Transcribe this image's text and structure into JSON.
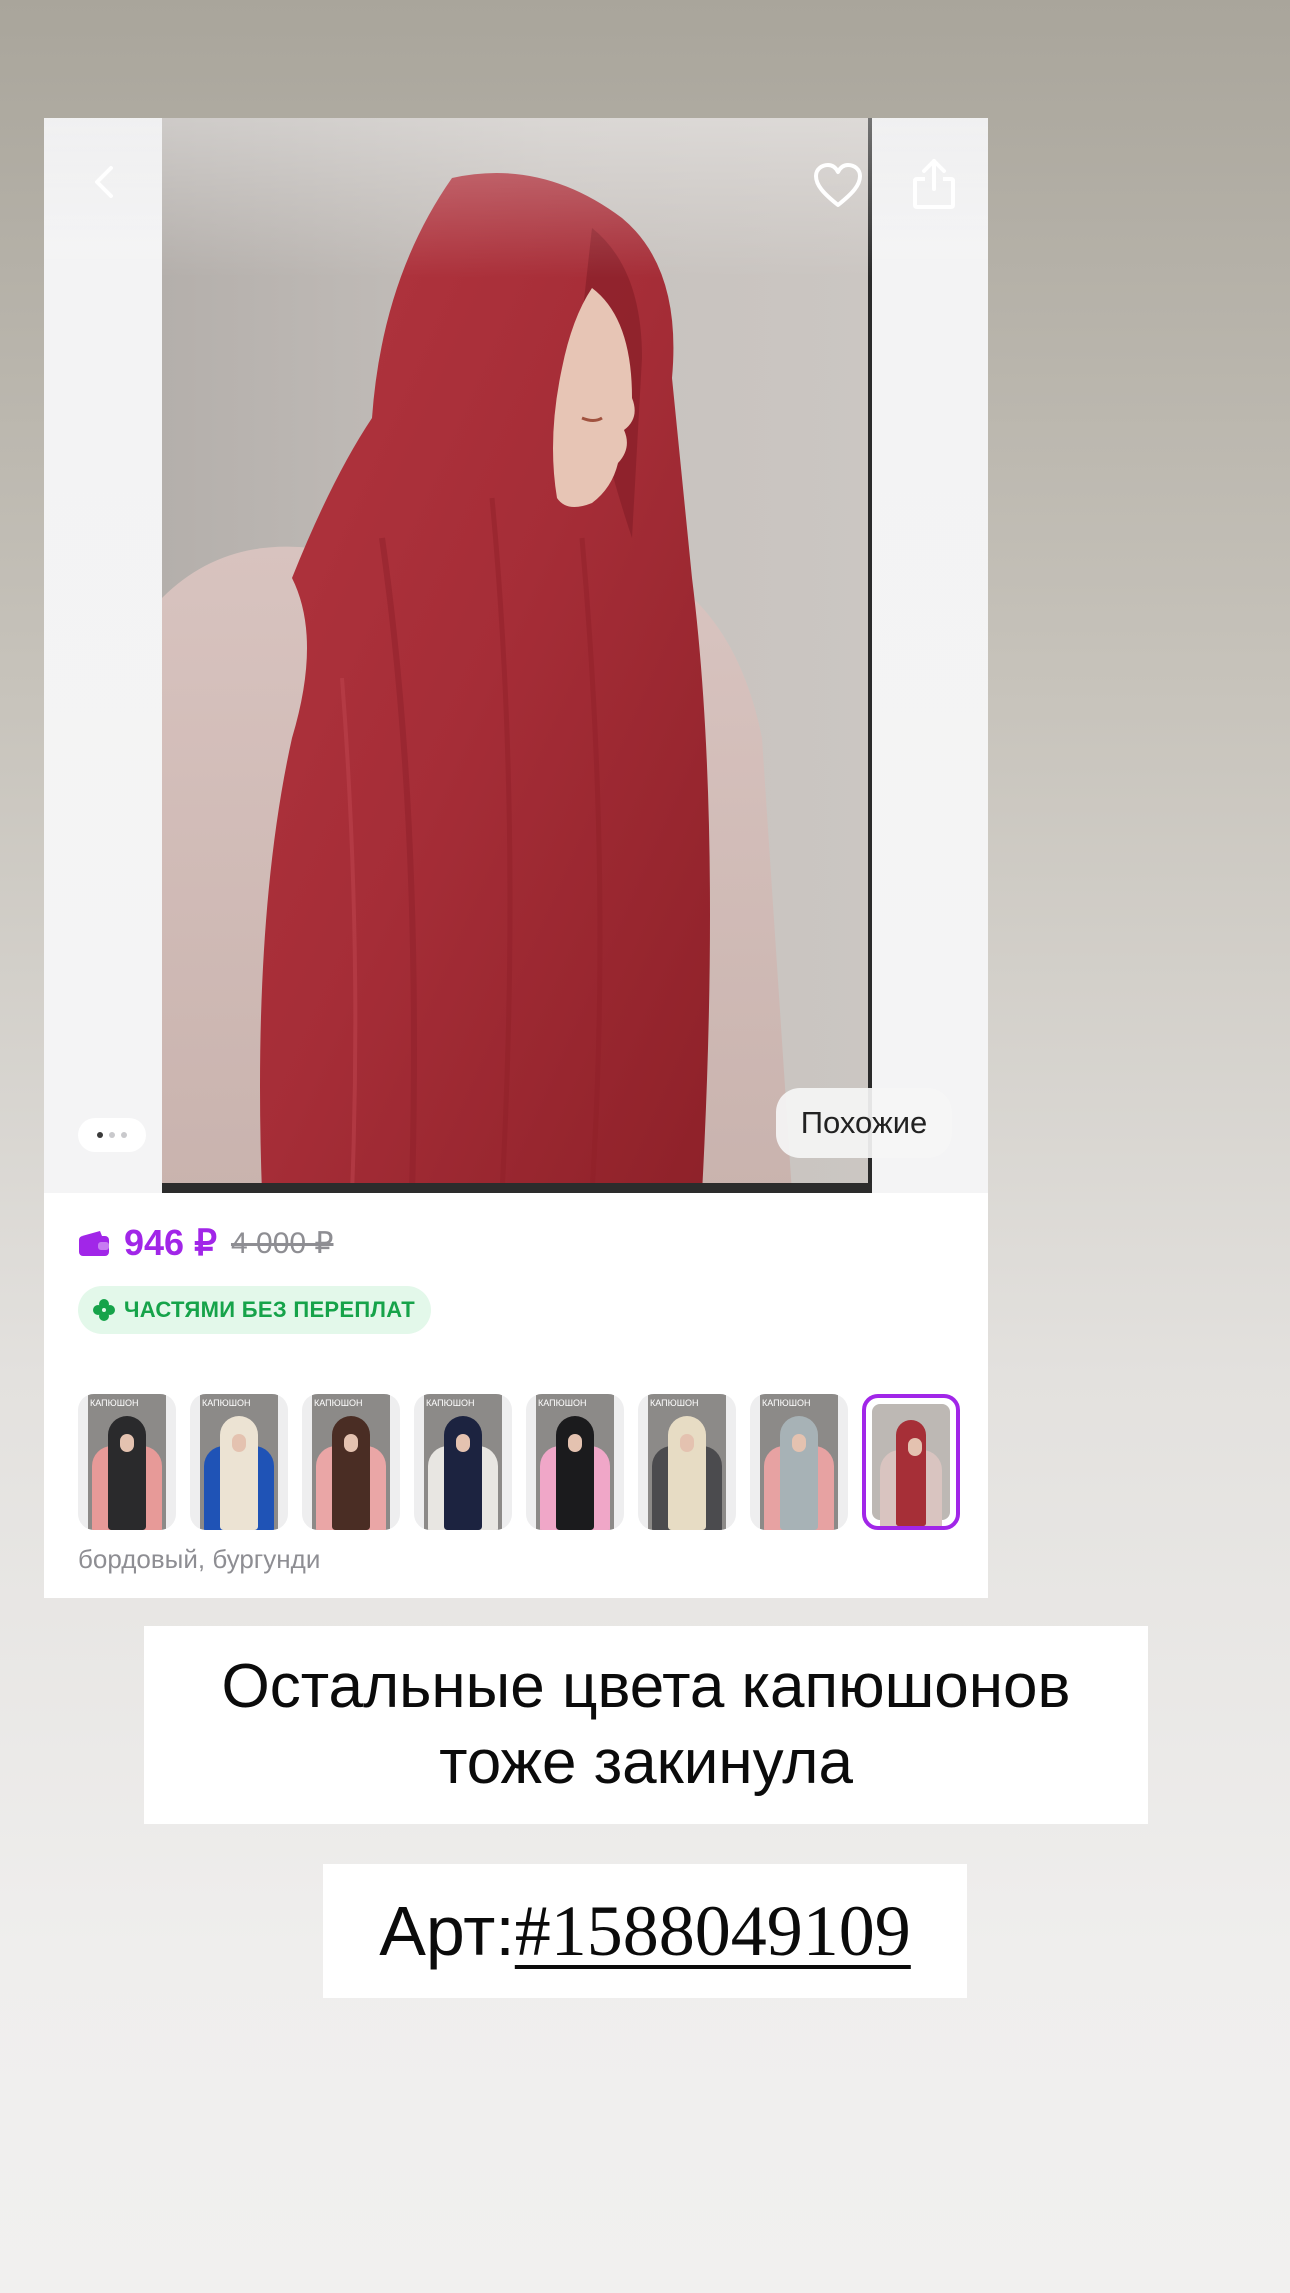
{
  "product": {
    "buttons": {
      "back_icon": "chevron-left-icon",
      "favorite_icon": "heart-icon",
      "share_icon": "share-icon"
    },
    "gallery": {
      "image_count": 3,
      "active_index": 0,
      "similar_label": "Похожие"
    },
    "price": {
      "current": "946 ₽",
      "old": "4 000 ₽",
      "accent_color": "#a126e8"
    },
    "installments": {
      "label": "ЧАСТЯМИ БЕЗ ПЕРЕПЛАТ",
      "color": "#16a34a"
    },
    "variants": {
      "thumbnail_text": "КАПЮШОН",
      "items": [
        {
          "color": "black",
          "hex": "#2a2a2c",
          "arms_hex": "#e79a98"
        },
        {
          "color": "cream",
          "hex": "#ece3d3",
          "arms_hex": "#1f53b6"
        },
        {
          "color": "brown",
          "hex": "#4a2d24",
          "arms_hex": "#eaa6a6"
        },
        {
          "color": "navy",
          "hex": "#1c2340",
          "arms_hex": "#e8e6e2"
        },
        {
          "color": "black",
          "hex": "#1b1b1d",
          "arms_hex": "#f0a7c8"
        },
        {
          "color": "beige",
          "hex": "#e7dcc4",
          "arms_hex": "#4b4b4e"
        },
        {
          "color": "grey-blue",
          "hex": "#a7b2b6",
          "arms_hex": "#e7a2a2"
        },
        {
          "color": "burgundy",
          "hex": "#a62f37",
          "arms_hex": "#d9c4c0",
          "selected": true
        }
      ],
      "selected_name": "бордовый, бургунди"
    }
  },
  "caption": {
    "line1": "Остальные цвета капюшонов",
    "line2": "тоже закинула"
  },
  "article": {
    "prefix": "Арт:",
    "code": "#1588049109"
  }
}
